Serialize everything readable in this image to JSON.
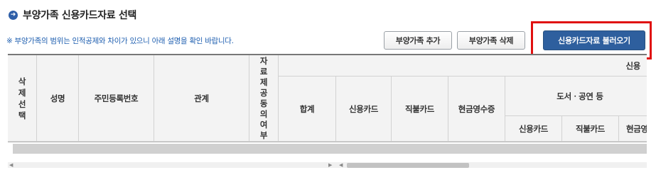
{
  "section": {
    "bullet_icon": "arrow-circle-icon",
    "title": "부양가족 신용카드자료 선택"
  },
  "notice": "※ 부양가족의 범위는 인적공제와 차이가 있으니 아래 설명을 확인 바랍니다.",
  "buttons": {
    "add": "부양가족 추가",
    "delete": "부양가족 삭제",
    "load": "신용카드자료 불러오기"
  },
  "colors": {
    "accent_blue": "#2e5f9e",
    "notice_blue": "#1f5fb0",
    "highlight_red": "#e01010"
  },
  "table": {
    "headers": {
      "delete_select": "삭제선택",
      "name": "성명",
      "resident_number": "주민등록번호",
      "relation": "관계",
      "data_provided": "자료제공동의여부",
      "credit_group": "신용",
      "total": "합계",
      "credit_card": "신용카드",
      "debit_card": "직불카드",
      "cash_receipt": "현금영수증",
      "books_culture": "도서ㆍ공연 등",
      "sub_credit_card": "신용카드",
      "sub_debit_card": "직불카드",
      "sub_cash": "현금영"
    }
  }
}
